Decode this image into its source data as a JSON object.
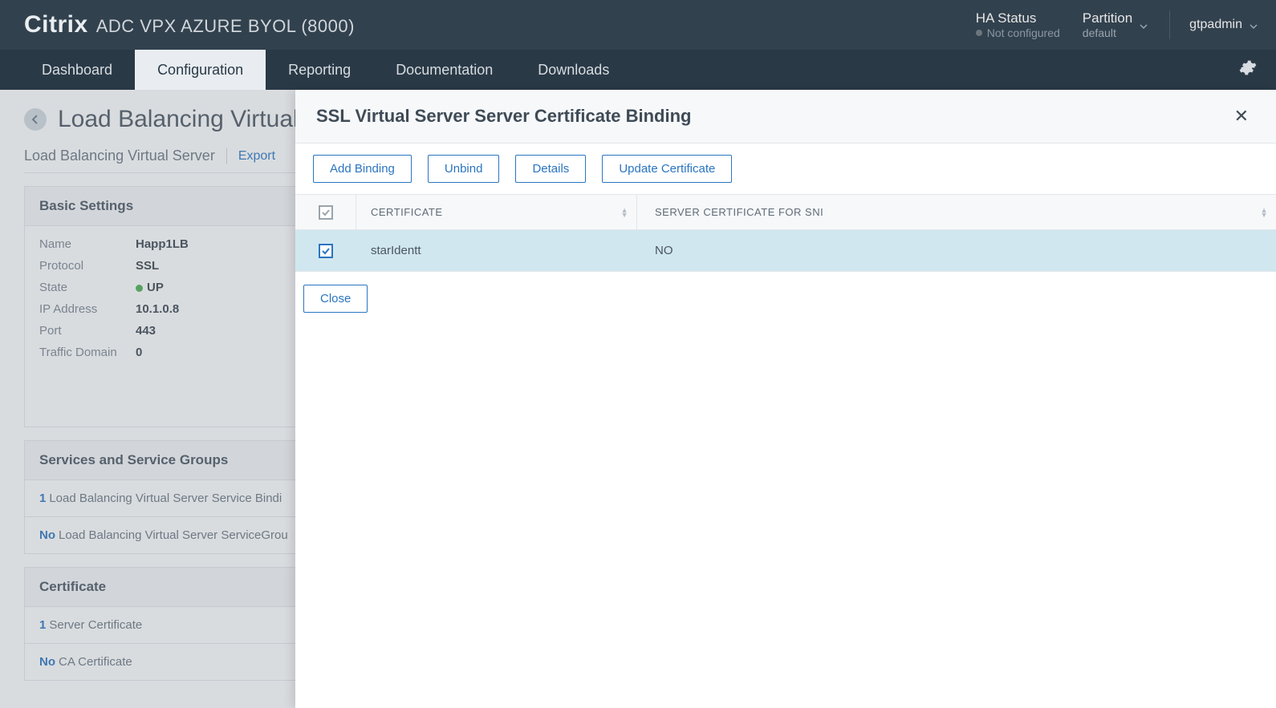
{
  "brand": {
    "main": "Citrix",
    "sub": "ADC VPX AZURE BYOL (8000)"
  },
  "ha": {
    "label": "HA Status",
    "value": "Not configured"
  },
  "partition": {
    "label": "Partition",
    "value": "default"
  },
  "user": {
    "name": "gtpadmin"
  },
  "nav": {
    "dashboard": "Dashboard",
    "configuration": "Configuration",
    "reporting": "Reporting",
    "documentation": "Documentation",
    "downloads": "Downloads"
  },
  "page": {
    "title": "Load Balancing Virtual",
    "breadcrumb": "Load Balancing Virtual Server",
    "export": "Export"
  },
  "basic": {
    "header": "Basic Settings",
    "name_k": "Name",
    "name_v": "Happ1LB",
    "protocol_k": "Protocol",
    "protocol_v": "SSL",
    "state_k": "State",
    "state_v": "UP",
    "ip_k": "IP Address",
    "ip_v": "10.1.0.8",
    "port_k": "Port",
    "port_v": "443",
    "td_k": "Traffic Domain",
    "td_v": "0"
  },
  "services": {
    "header": "Services and Service Groups",
    "row1_cnt": "1",
    "row1_txt": "Load Balancing Virtual Server Service Bindi",
    "row2_cnt": "No",
    "row2_txt": "Load Balancing Virtual Server ServiceGrou"
  },
  "cert_panel": {
    "header": "Certificate",
    "row1_cnt": "1",
    "row1_txt": "Server Certificate",
    "row2_cnt": "No",
    "row2_txt": "CA Certificate"
  },
  "modal": {
    "title": "SSL Virtual Server Server Certificate Binding",
    "add": "Add Binding",
    "unbind": "Unbind",
    "details": "Details",
    "update": "Update Certificate",
    "col_cert": "CERTIFICATE",
    "col_sni": "SERVER CERTIFICATE FOR SNI",
    "row": {
      "cert": "starIdentt",
      "sni": "NO"
    },
    "close": "Close"
  }
}
